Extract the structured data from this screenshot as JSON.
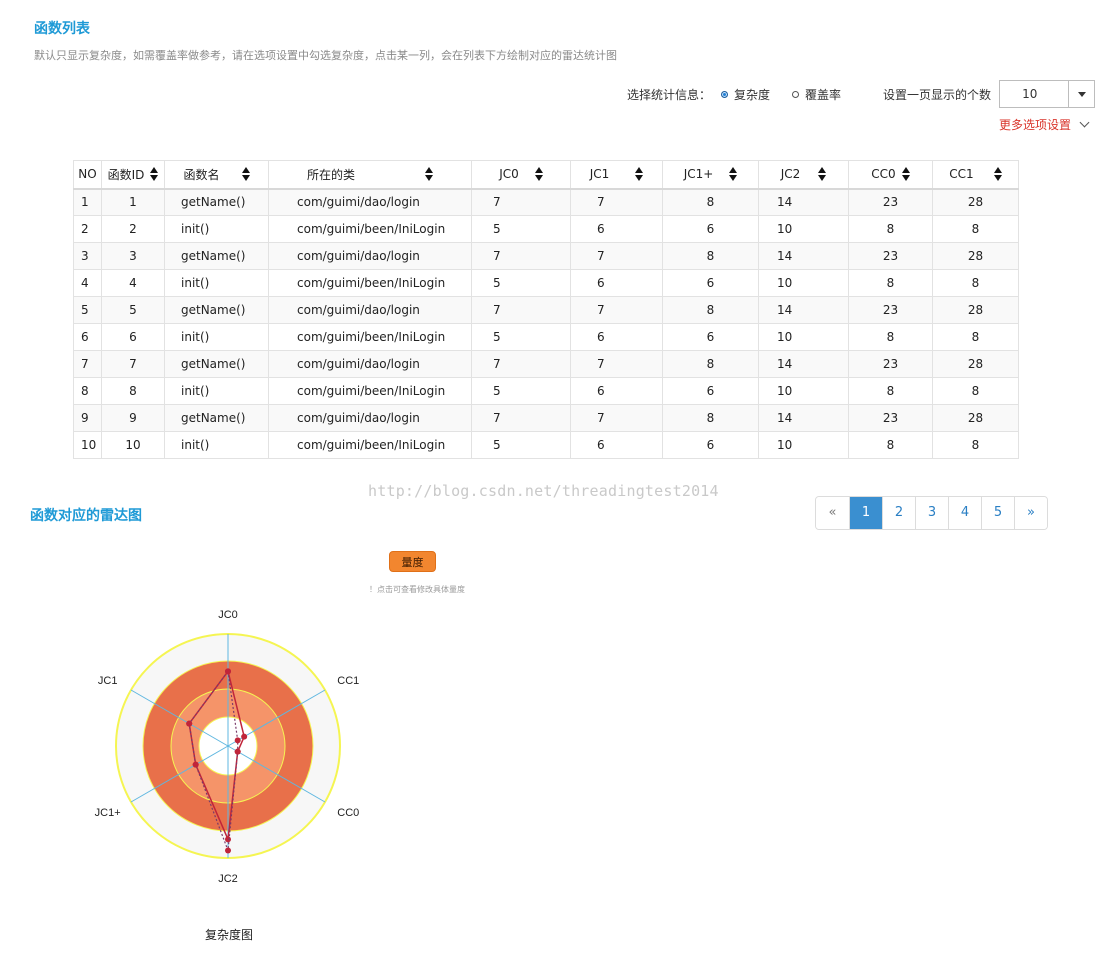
{
  "header": {
    "title": "函数列表",
    "description": "默认只显示复杂度，如需覆盖率做参考，请在选项设置中勾选复杂度，点击某一列，会在列表下方绘制对应的雷达统计图"
  },
  "options": {
    "stat_label": "选择统计信息：",
    "radio_complexity": "复杂度",
    "radio_coverage": "覆盖率",
    "page_size_label": "设置一页显示的个数",
    "page_size_value": "10",
    "more_settings": "更多选项设置"
  },
  "table": {
    "headers": [
      "NO",
      "函数ID",
      "函数名",
      "所在的类",
      "JC0",
      "JC1",
      "JC1+",
      "JC2",
      "CC0",
      "CC1"
    ],
    "rows": [
      [
        "1",
        "1",
        "getName()",
        "com/guimi/dao/login",
        "7",
        "7",
        "8",
        "14",
        "23",
        "28"
      ],
      [
        "2",
        "2",
        "init()",
        "com/guimi/been/IniLogin",
        "5",
        "6",
        "6",
        "10",
        "8",
        "8"
      ],
      [
        "3",
        "3",
        "getName()",
        "com/guimi/dao/login",
        "7",
        "7",
        "8",
        "14",
        "23",
        "28"
      ],
      [
        "4",
        "4",
        "init()",
        "com/guimi/been/IniLogin",
        "5",
        "6",
        "6",
        "10",
        "8",
        "8"
      ],
      [
        "5",
        "5",
        "getName()",
        "com/guimi/dao/login",
        "7",
        "7",
        "8",
        "14",
        "23",
        "28"
      ],
      [
        "6",
        "6",
        "init()",
        "com/guimi/been/IniLogin",
        "5",
        "6",
        "6",
        "10",
        "8",
        "8"
      ],
      [
        "7",
        "7",
        "getName()",
        "com/guimi/dao/login",
        "7",
        "7",
        "8",
        "14",
        "23",
        "28"
      ],
      [
        "8",
        "8",
        "init()",
        "com/guimi/been/IniLogin",
        "5",
        "6",
        "6",
        "10",
        "8",
        "8"
      ],
      [
        "9",
        "9",
        "getName()",
        "com/guimi/dao/login",
        "7",
        "7",
        "8",
        "14",
        "23",
        "28"
      ],
      [
        "10",
        "10",
        "init()",
        "com/guimi/been/IniLogin",
        "5",
        "6",
        "6",
        "10",
        "8",
        "8"
      ]
    ]
  },
  "watermark": "http://blog.csdn.net/threadingtest2014",
  "radar_section": {
    "title": "函数对应的雷达图",
    "button": "量度",
    "hint": "！点击可查看修改具体量度",
    "caption": "复杂度图"
  },
  "pagination": {
    "prev": "«",
    "pages": [
      "1",
      "2",
      "3",
      "4",
      "5"
    ],
    "active": "1",
    "next": "»"
  },
  "colors": {
    "accent": "#1f9ad6",
    "link_red": "#d9342b",
    "button_orange": "#f2862f",
    "ring_dark": "#e8704a",
    "ring_light": "#f59469",
    "ring_outline": "#f5f552",
    "series": "#c0253a"
  },
  "chart_data": {
    "type": "radar",
    "axes": [
      "JC0",
      "CC1",
      "CC0",
      "JC2",
      "JC1+",
      "JC1"
    ],
    "rmax": 3,
    "series": [
      {
        "style": "solid",
        "values": [
          2.0,
          0.5,
          0.3,
          2.5,
          1.0,
          1.2
        ]
      },
      {
        "style": "dotted",
        "values": [
          2.0,
          0.3,
          0.3,
          2.8,
          1.0,
          1.2
        ]
      }
    ]
  }
}
